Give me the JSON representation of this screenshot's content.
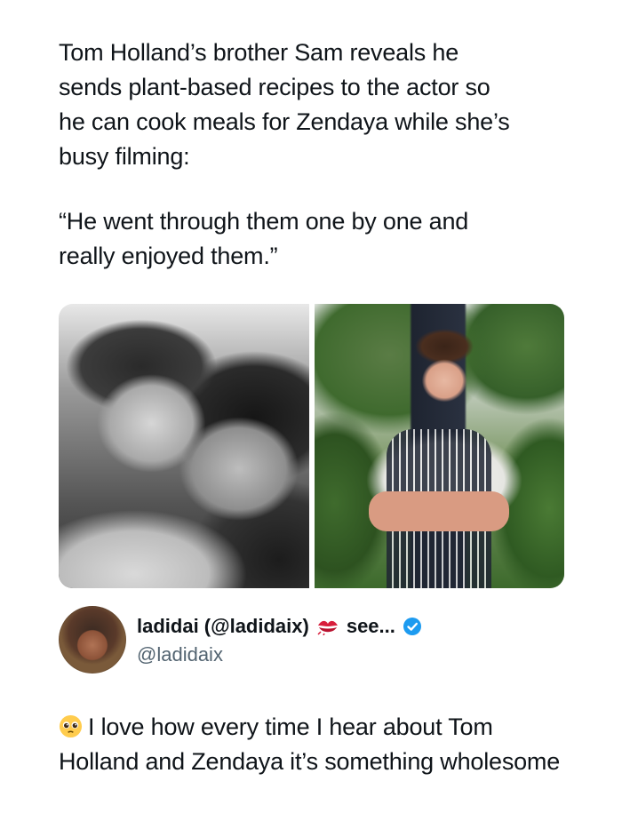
{
  "post": {
    "text": "Tom Holland’s brother Sam reveals he\nsends plant-based recipes to the actor so\nhe can cook meals for Zendaya while she’s\nbusy filming:",
    "quote": "“He went through them one by one and\nreally enjoyed them.”"
  },
  "media": {
    "left_photo_icon": "photo-black-white-couple",
    "right_photo_icon": "photo-chef-in-garden"
  },
  "reply": {
    "author_name": "ladidai (@ladidaix)",
    "name_suffix": "see...",
    "handle": "@ladidaix",
    "emoji_icon": "pleading-face-icon",
    "text": "I love how every time I hear about Tom Holland and Zendaya it’s something wholesome",
    "verified_color": "#1d9bf0",
    "kiss_color": "#d81e3c"
  }
}
